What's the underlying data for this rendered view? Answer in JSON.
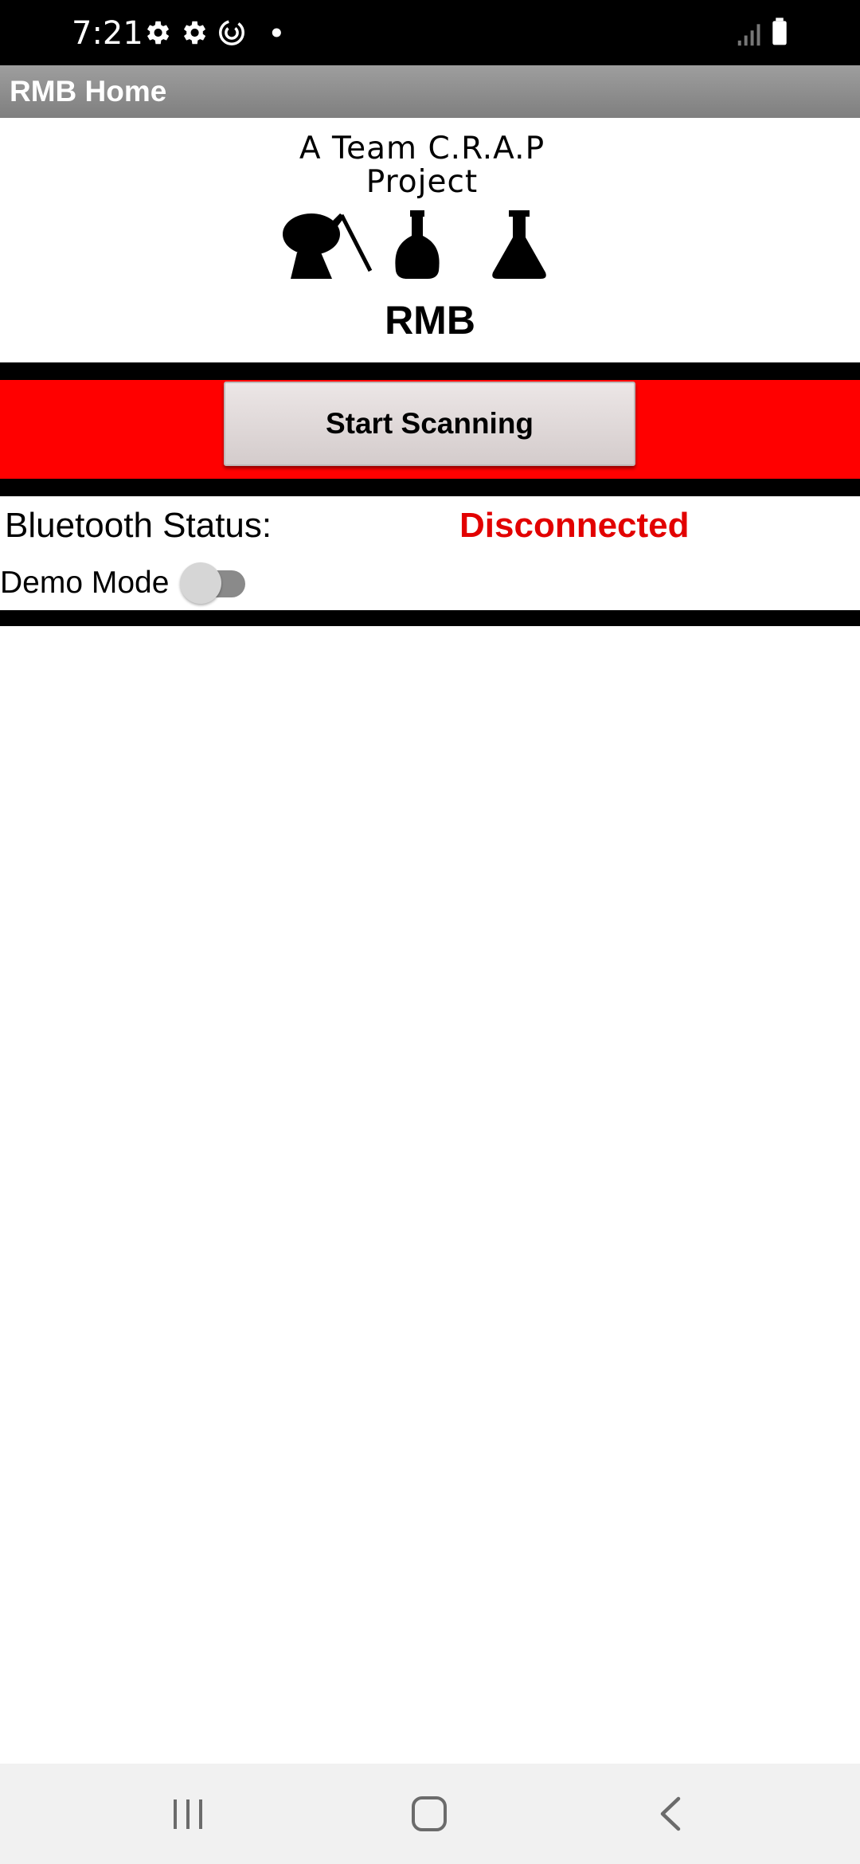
{
  "status_bar": {
    "time": "7:21",
    "left_icons": [
      "gear-icon",
      "gear-icon",
      "sync-icon",
      "notification-dot-icon"
    ],
    "right_icons": [
      "signal-icon",
      "battery-icon"
    ]
  },
  "title_bar": {
    "title": "RMB Home",
    "background": "#8c8c8c"
  },
  "logo": {
    "line1": "A Team C.R.A.P",
    "line2": "Project",
    "icons": [
      "kiwi-bird-icon",
      "potion-bottle-icon",
      "flask-icon"
    ]
  },
  "app_name": "RMB",
  "scan": {
    "button_label": "Start Scanning",
    "band_color": "#ff0000"
  },
  "bluetooth": {
    "label": "Bluetooth Status:",
    "status": "Disconnected",
    "status_color": "#e20000"
  },
  "demo_mode": {
    "label": "Demo Mode",
    "enabled": false
  },
  "nav_bar": {
    "buttons": [
      "recent-apps-icon",
      "home-icon",
      "back-icon"
    ]
  }
}
